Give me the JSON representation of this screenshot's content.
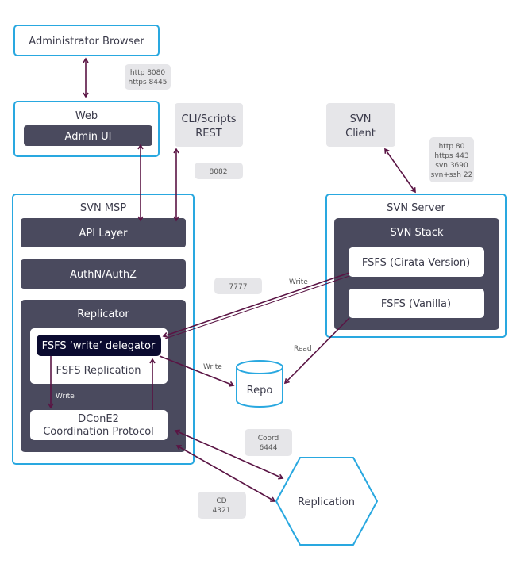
{
  "colors": {
    "border": "#29a8e0",
    "dark": "#4a4a5e",
    "navy": "#0b0b30",
    "arrow": "#5a1444",
    "badge": "#e6e6e9"
  },
  "nodes": {
    "admin_browser": "Administrator Browser",
    "web": "Web",
    "admin_ui": "Admin UI",
    "cli_line1": "CLI/Scripts",
    "cli_line2": "REST",
    "svn_msp": "SVN MSP",
    "api_layer": "API Layer",
    "authn": "AuthN/AuthZ",
    "replicator": "Replicator",
    "delegator": "FSFS ‘write’ delegator",
    "fsfs_replication": "FSFS Replication",
    "dcone_line1": "DConE2",
    "dcone_line2": "Coordination Protocol",
    "svn_client_line1": "SVN",
    "svn_client_line2": "Client",
    "svn_server": "SVN Server",
    "svn_stack": "SVN Stack",
    "fsfs_cirata": "FSFS (Cirata Version)",
    "fsfs_vanilla": "FSFS (Vanilla)",
    "repo": "Repo",
    "replication": "Replication"
  },
  "badges": {
    "web_ports": [
      "http 8080",
      "https 8445"
    ],
    "cli_port": "8082",
    "svn_ports": [
      "http 80",
      "https 443",
      "svn 3690",
      "svn+ssh 22"
    ],
    "port_7777": "7777",
    "coord": [
      "Coord",
      "6444"
    ],
    "cd": [
      "CD",
      "4321"
    ]
  },
  "labels": {
    "write1": "Write",
    "read": "Read",
    "write2": "Write",
    "write3": "Write"
  }
}
